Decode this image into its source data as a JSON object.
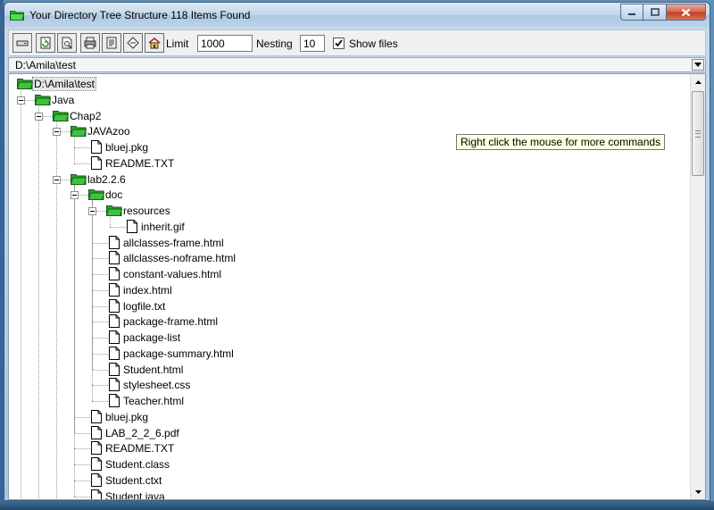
{
  "window": {
    "title": "Your Directory Tree Structure 118 Items Found"
  },
  "toolbar": {
    "buttons": [
      {
        "name": "drive-icon"
      },
      {
        "name": "refresh-icon"
      },
      {
        "name": "preview-icon"
      },
      {
        "name": "print-icon"
      },
      {
        "name": "notes-icon"
      },
      {
        "name": "stamp-icon"
      },
      {
        "name": "home-icon"
      }
    ],
    "limit_label": "Limit",
    "limit_value": "1000",
    "nesting_label": "Nesting",
    "nesting_value": "10",
    "show_files_label": "Show files",
    "show_files_checked": true
  },
  "path": {
    "value": "D:\\Amila\\test"
  },
  "tooltip": {
    "text": "Right click the mouse for more commands"
  },
  "tree": {
    "root": "D:\\Amila\\test",
    "java": "Java",
    "chap2": "Chap2",
    "javazoo": "JAVAzoo",
    "javazoo_files": [
      "bluej.pkg",
      "README.TXT"
    ],
    "lab": "lab2.2.6",
    "doc": "doc",
    "resources": "resources",
    "resources_files": [
      "inherit.gif"
    ],
    "doc_files": [
      "allclasses-frame.html",
      "allclasses-noframe.html",
      "constant-values.html",
      "index.html",
      "logfile.txt",
      "package-frame.html",
      "package-list",
      "package-summary.html",
      "Student.html",
      "stylesheet.css",
      "Teacher.html"
    ],
    "lab_files": [
      "bluej.pkg",
      "LAB_2_2_6.pdf",
      "README.TXT",
      "Student.class",
      "Student.ctxt",
      "Student.java"
    ]
  },
  "colors": {
    "folder": "#3cc43c",
    "selection": "#e8e8e8",
    "tooltip_bg": "#ffffe1"
  }
}
